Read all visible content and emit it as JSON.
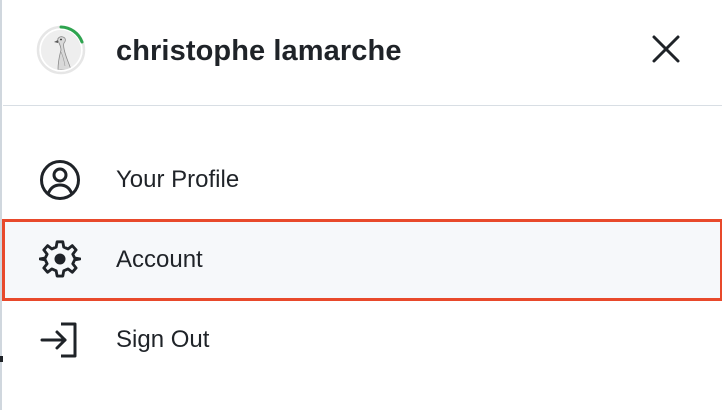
{
  "user": {
    "name": "christophe lamarche",
    "avatar_icon": "goose-avatar",
    "status_ring_color": "#2ea44f"
  },
  "header": {
    "close_icon": "close-icon"
  },
  "menu": {
    "items": [
      {
        "label": "Your Profile",
        "icon": "user-circle-icon",
        "selected": false
      },
      {
        "label": "Account",
        "icon": "gear-icon",
        "selected": true
      },
      {
        "label": "Sign Out",
        "icon": "sign-out-icon",
        "selected": false
      }
    ]
  },
  "colors": {
    "highlight_border": "#e8492b",
    "selected_background": "#f6f8fa",
    "text": "#1f2328",
    "divider": "#d8dee4"
  }
}
